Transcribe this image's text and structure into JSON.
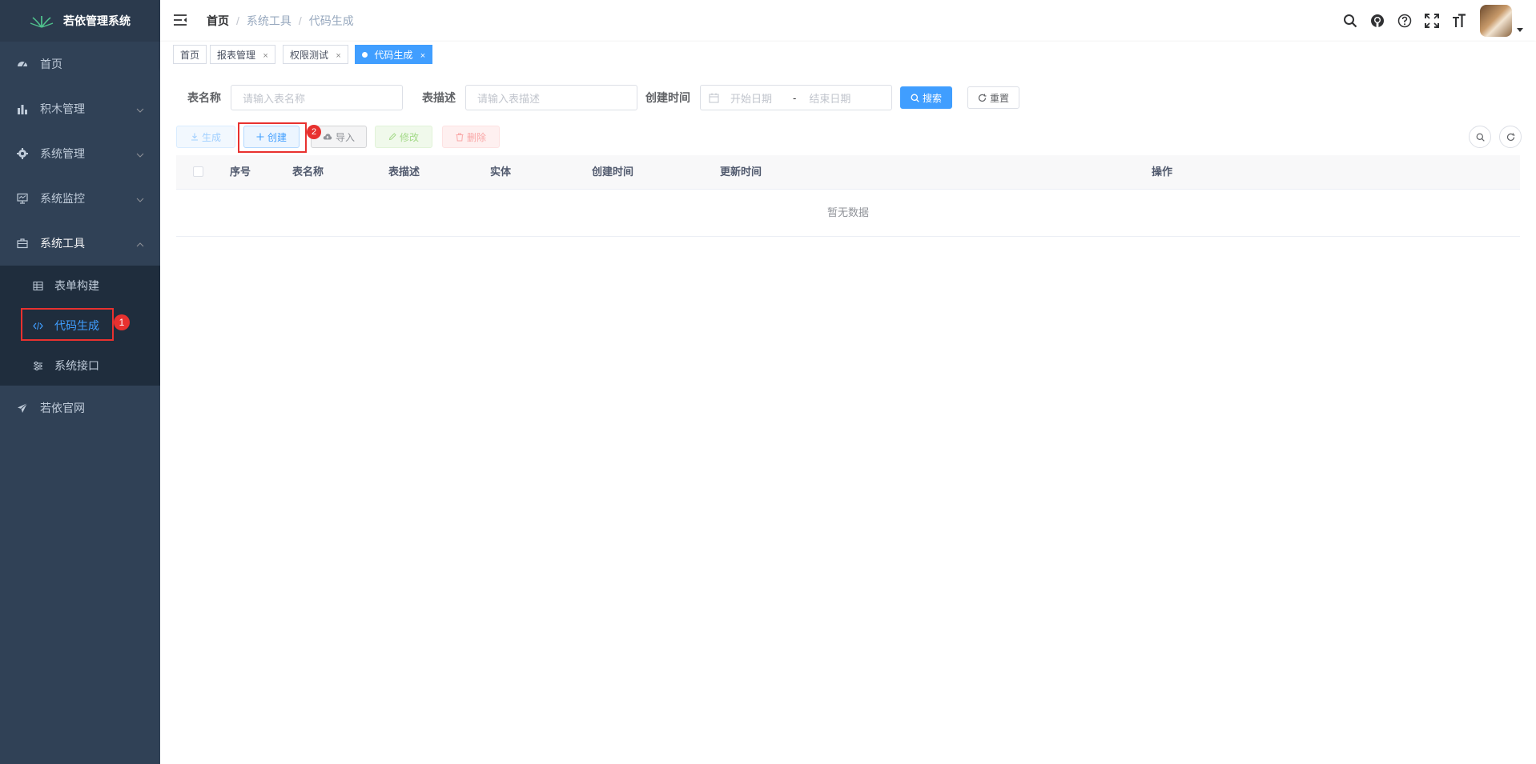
{
  "app": {
    "title": "若依管理系统"
  },
  "sidebar": {
    "items": [
      {
        "label": "首页",
        "icon": "dashboard-icon"
      },
      {
        "label": "积木管理",
        "icon": "bar-chart-icon"
      },
      {
        "label": "系统管理",
        "icon": "gear-icon"
      },
      {
        "label": "系统监控",
        "icon": "monitor-icon"
      },
      {
        "label": "系统工具",
        "icon": "toolbox-icon"
      }
    ],
    "subitems": [
      {
        "label": "表单构建",
        "icon": "table-icon"
      },
      {
        "label": "代码生成",
        "icon": "code-icon"
      },
      {
        "label": "系统接口",
        "icon": "sliders-icon"
      }
    ],
    "last_item": {
      "label": "若依官网",
      "icon": "send-icon"
    }
  },
  "breadcrumb": [
    "首页",
    "系统工具",
    "代码生成"
  ],
  "breadcrumb_sep": "/",
  "tags": [
    {
      "label": "首页"
    },
    {
      "label": "报表管理",
      "close": "×"
    },
    {
      "label": "权限测试",
      "close": "×"
    },
    {
      "label": "代码生成",
      "close": "×"
    }
  ],
  "search_form": {
    "table_name_label": "表名称",
    "table_name_placeholder": "请输入表名称",
    "table_desc_label": "表描述",
    "table_desc_placeholder": "请输入表描述",
    "create_time_label": "创建时间",
    "start_date_placeholder": "开始日期",
    "range_sep": "-",
    "end_date_placeholder": "结束日期",
    "search_button": "搜索",
    "reset_button": "重置"
  },
  "toolbar": {
    "generate": "生成",
    "create": "创建",
    "import": "导入",
    "edit": "修改",
    "delete": "删除"
  },
  "table": {
    "columns": [
      "序号",
      "表名称",
      "表描述",
      "实体",
      "创建时间",
      "更新时间",
      "操作"
    ],
    "empty_text": "暂无数据"
  },
  "annotations": {
    "one": "1",
    "two": "2"
  },
  "colors": {
    "sidebar_bg": "#304156",
    "submenu_bg": "#1f2d3d",
    "accent": "#409eff",
    "highlight": "#e8312f"
  }
}
